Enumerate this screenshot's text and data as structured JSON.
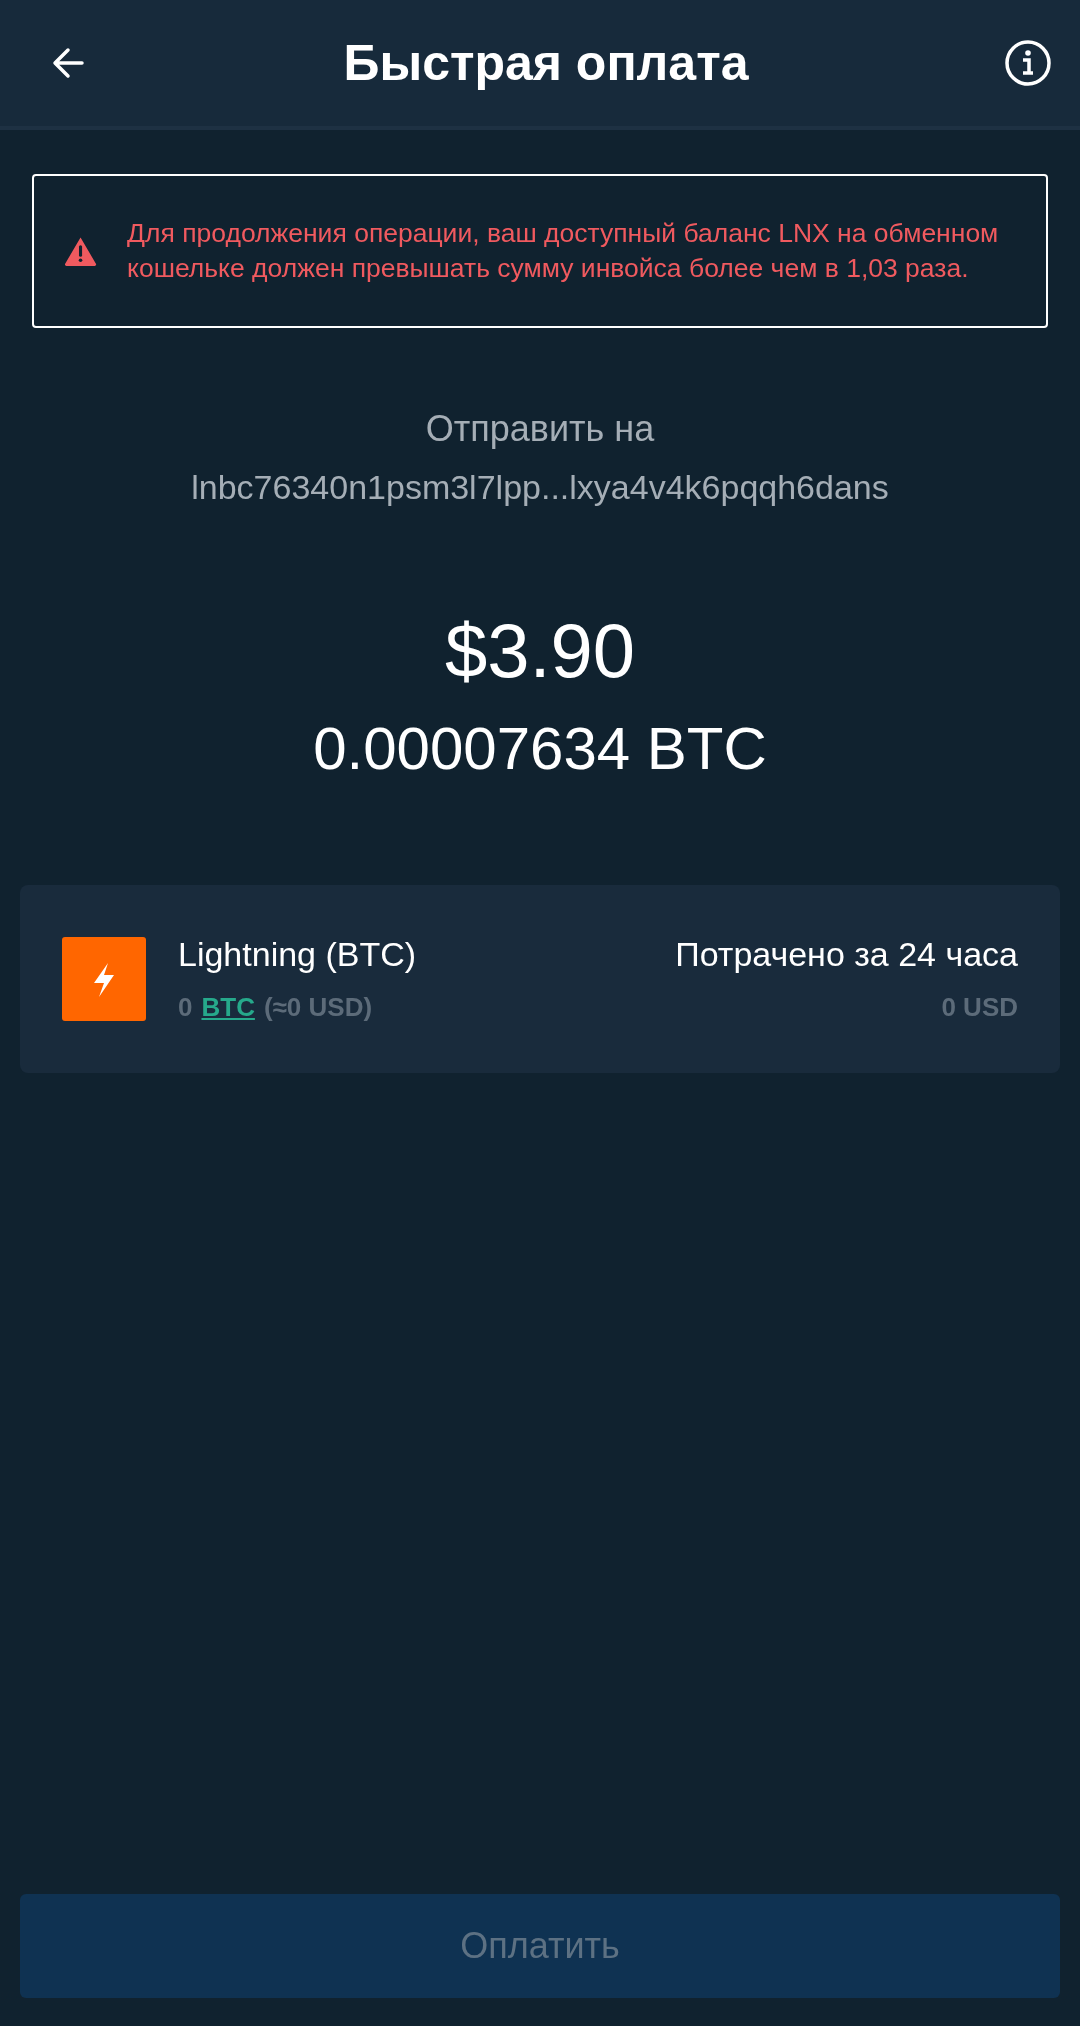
{
  "header": {
    "title": "Быстрая оплата"
  },
  "warning": {
    "text": "Для продолжения операции, ваш доступный баланс LNX на обменном кошельке должен превышать сумму инвойса более чем в 1,03 раза."
  },
  "recipient": {
    "label": "Отправить на",
    "address": "lnbc76340n1psm3l7lpp...lxya4v4k6pqqh6dans"
  },
  "amount": {
    "fiat": "$3.90",
    "crypto": "0.00007634 BTC"
  },
  "wallet": {
    "name": "Lightning (BTC)",
    "balance_amount": "0",
    "balance_currency": "BTC",
    "balance_fiat": "(≈0 USD)",
    "spent_label": "Потрачено за 24 часа",
    "spent_value": "0 USD"
  },
  "pay_button": {
    "label": "Оплатить",
    "disabled": true
  }
}
